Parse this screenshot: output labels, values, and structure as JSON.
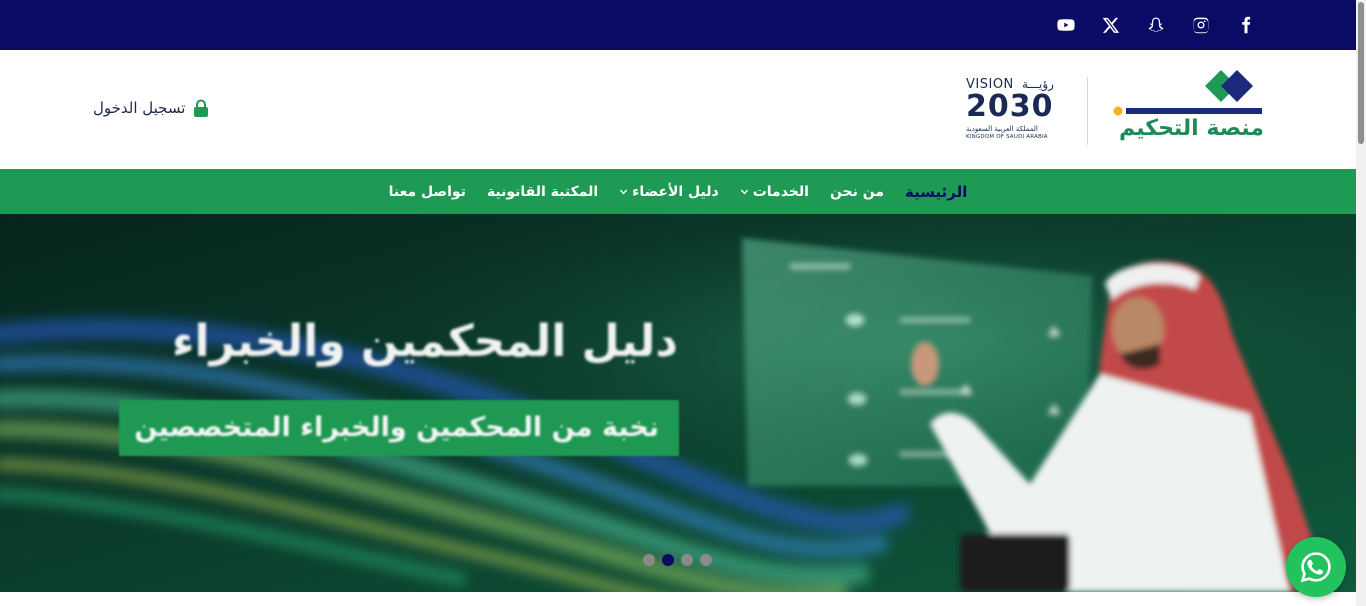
{
  "social": {
    "icons": [
      "youtube-icon",
      "x-icon",
      "snapchat-icon",
      "instagram-icon",
      "facebook-icon"
    ]
  },
  "header": {
    "login_label": "تسجيل الدخول",
    "vision": {
      "title": "VISION",
      "title_ar": "رؤيـــة",
      "year": "2030",
      "subtitle_ar": "المملكة العربية السعودية",
      "subtitle_en": "KINGDOM OF SAUDI ARABIA"
    },
    "brand_name": "منصة التحكيم"
  },
  "nav": {
    "items": [
      {
        "label": "الرئيسية",
        "active": true,
        "dropdown": false
      },
      {
        "label": "من نحن",
        "active": false,
        "dropdown": false
      },
      {
        "label": "الخدمات",
        "active": false,
        "dropdown": true
      },
      {
        "label": "دليل الأعضاء",
        "active": false,
        "dropdown": true
      },
      {
        "label": "المكتبة القانونية",
        "active": false,
        "dropdown": false
      },
      {
        "label": "تواصل معنا",
        "active": false,
        "dropdown": false
      }
    ]
  },
  "hero": {
    "title": "دليل المحكمين والخبراء",
    "subtitle": "نخبة من  المحكمين والخبراء المتخصصين",
    "slides_count": 4,
    "active_slide": 2
  },
  "colors": {
    "topbar": "#0b0b66",
    "nav": "#1f9a55",
    "active_nav": "#0b0b66",
    "brand_green": "#1e8a5a",
    "whatsapp": "#22c35e"
  }
}
